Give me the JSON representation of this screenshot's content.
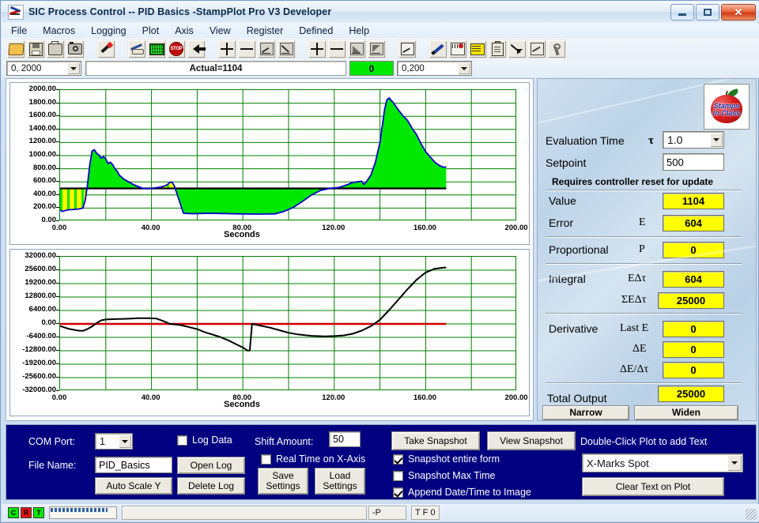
{
  "window": {
    "title": "SIC Process Control -- PID Basics -StampPlot Pro V3 Developer",
    "minimize_label": "Minimize",
    "maximize_label": "Maximize",
    "close_label": "Close"
  },
  "menu": {
    "items": [
      "File",
      "Macros",
      "Logging",
      "Plot",
      "Axis",
      "View",
      "Register",
      "Defined",
      "Help"
    ]
  },
  "toolbar": {
    "groups": [
      {
        "buttons": [
          {
            "name": "open-file-icon",
            "icon": "folder"
          },
          {
            "name": "save-file-icon",
            "icon": "disk"
          },
          {
            "name": "print-icon",
            "icon": "printer"
          },
          {
            "name": "snapshot-camera-icon",
            "icon": "camera"
          }
        ]
      },
      {
        "buttons": [
          {
            "name": "wand-icon",
            "icon": "wand"
          }
        ]
      },
      {
        "buttons": [
          {
            "name": "connect-icon",
            "icon": "science"
          },
          {
            "name": "display-icon",
            "icon": "display"
          },
          {
            "name": "stop-icon",
            "icon": "stop"
          },
          {
            "name": "back-arrow-icon",
            "icon": "arrow-left"
          }
        ]
      },
      {
        "buttons": [
          {
            "name": "y-zoom-in-icon",
            "icon": "plus"
          },
          {
            "name": "y-zoom-out-icon",
            "icon": "minus"
          },
          {
            "name": "y-scale-up-icon",
            "icon": "box-up"
          },
          {
            "name": "y-scale-down-icon",
            "icon": "box-down"
          }
        ]
      },
      {
        "buttons": [
          {
            "name": "x-zoom-in-icon",
            "icon": "plus"
          },
          {
            "name": "x-zoom-out-icon",
            "icon": "minus"
          },
          {
            "name": "x-scale-up-icon",
            "icon": "box-tri"
          },
          {
            "name": "x-scale-down-icon",
            "icon": "box-tri2"
          }
        ]
      },
      {
        "buttons": [
          {
            "name": "autoscale-icon",
            "icon": "chart"
          }
        ]
      },
      {
        "buttons": [
          {
            "name": "pen-icon",
            "icon": "pen"
          },
          {
            "name": "text-icon",
            "icon": "abc"
          },
          {
            "name": "note-icon",
            "icon": "note"
          },
          {
            "name": "clipboard-icon",
            "icon": "clip"
          },
          {
            "name": "pointer-icon",
            "icon": "arrow-dr"
          },
          {
            "name": "trend-icon",
            "icon": "zigzag"
          },
          {
            "name": "settings-wrench-icon",
            "icon": "wrench"
          }
        ]
      }
    ]
  },
  "toolrow2": {
    "y_range_value": "0, 2000",
    "status_text": "Actual=1104",
    "counter_value": "0",
    "x_range_value": "0,200"
  },
  "chart_data": [
    {
      "type": "area",
      "name": "process-value-chart",
      "title": "",
      "xlabel": "Seconds",
      "ylabel": "",
      "xlim": [
        0,
        200
      ],
      "ylim": [
        0,
        2000
      ],
      "xticks": [
        "0.00",
        "40.00",
        "80.00",
        "120.00",
        "160.00",
        "200.00"
      ],
      "xtick_values": [
        0,
        40,
        80,
        120,
        160,
        200
      ],
      "yticks": [
        "0.00",
        "200.00",
        "400.00",
        "600.00",
        "800.00",
        "1000.00",
        "1200.00",
        "1400.00",
        "1600.00",
        "1800.00",
        "2000.00"
      ],
      "ytick_values": [
        0,
        200,
        400,
        600,
        800,
        1000,
        1200,
        1400,
        1600,
        1800,
        2000
      ],
      "grid": true,
      "grid_color": "#008000",
      "setpoint": 500,
      "setpoint_color": "#000000",
      "fill_color": "#00e800",
      "hatch_color": "#ffff00",
      "series": [
        {
          "name": "Actual",
          "color": "#0000cd",
          "x": [
            0,
            1,
            2,
            3,
            4,
            6,
            8,
            10,
            11,
            12,
            13,
            14,
            15,
            16,
            17,
            18,
            19,
            20,
            21,
            22,
            23,
            24,
            25,
            26,
            28,
            30,
            32,
            34,
            36,
            38,
            40,
            42,
            44,
            46,
            47,
            48,
            49,
            50,
            54,
            58,
            62,
            66,
            70,
            74,
            78,
            82,
            86,
            90,
            94,
            98,
            102,
            106,
            110,
            114,
            118,
            122,
            126,
            128,
            130,
            132,
            133,
            134,
            136,
            138,
            140,
            142,
            143,
            144,
            146,
            148,
            150,
            152,
            154,
            156,
            158,
            160,
            162,
            164,
            166,
            168,
            169
          ],
          "y": [
            170,
            150,
            160,
            170,
            175,
            180,
            185,
            200,
            320,
            560,
            860,
            1070,
            1090,
            1035,
            1010,
            960,
            985,
            950,
            880,
            900,
            860,
            800,
            760,
            700,
            640,
            600,
            560,
            530,
            505,
            495,
            500,
            510,
            520,
            540,
            560,
            590,
            595,
            540,
            120,
            115,
            118,
            120,
            118,
            115,
            112,
            110,
            108,
            110,
            112,
            150,
            210,
            300,
            400,
            470,
            500,
            515,
            560,
            590,
            600,
            610,
            560,
            600,
            700,
            900,
            1200,
            1700,
            1850,
            1880,
            1800,
            1700,
            1610,
            1540,
            1420,
            1320,
            1180,
            1060,
            980,
            900,
            850,
            820,
            830
          ]
        }
      ]
    },
    {
      "type": "line",
      "name": "output-chart",
      "title": "",
      "xlabel": "Seconds",
      "ylabel": "",
      "xlim": [
        0,
        200
      ],
      "ylim": [
        -32000,
        32000
      ],
      "xticks": [
        "0.00",
        "40.00",
        "80.00",
        "120.00",
        "160.00",
        "200.00"
      ],
      "xtick_values": [
        0,
        40,
        80,
        120,
        160,
        200
      ],
      "yticks": [
        "32000.00",
        "25600.00",
        "19200.00",
        "12800.00",
        "6400.00",
        "0.00",
        "-6400.00",
        "-12800.00",
        "-19200.00",
        "-25600.00",
        "-32000.00"
      ],
      "ytick_values": [
        32000,
        25600,
        19200,
        12800,
        6400,
        0,
        -6400,
        -12800,
        -19200,
        -25600,
        -32000
      ],
      "grid": true,
      "grid_color": "#008000",
      "zero_line_color": "#d00000",
      "series": [
        {
          "name": "Total Output",
          "color": "#000000",
          "x": [
            0,
            4,
            8,
            10,
            12,
            14,
            16,
            18,
            20,
            24,
            28,
            32,
            34,
            38,
            42,
            44,
            46,
            48,
            52,
            56,
            60,
            64,
            66,
            70,
            74,
            78,
            80,
            82,
            83,
            84,
            88,
            92,
            96,
            100,
            104,
            110,
            116,
            120,
            124,
            128,
            132,
            136,
            140,
            144,
            148,
            152,
            156,
            160,
            164,
            168,
            169
          ],
          "y": [
            -1000,
            -2400,
            -3200,
            -3300,
            -2400,
            -1200,
            400,
            1700,
            2100,
            2300,
            2400,
            2600,
            2700,
            2700,
            2600,
            1800,
            1000,
            0,
            -400,
            -1400,
            -2500,
            -4200,
            -4800,
            -6200,
            -8000,
            -10200,
            -11200,
            -12700,
            -12700,
            0,
            -900,
            -1800,
            -3000,
            -4200,
            -5000,
            -5700,
            -5900,
            -5800,
            -5500,
            -4700,
            -3200,
            -1100,
            2000,
            6600,
            11500,
            16500,
            21000,
            24500,
            26300,
            26800,
            26800
          ]
        }
      ]
    }
  ],
  "pid_panel": {
    "logo_alt": "Stamps in Class",
    "logo_line1": "Stamps",
    "logo_line2": "in Class",
    "evaluation_time_label": "Evaluation Time",
    "evaluation_time_symbol": "τ",
    "evaluation_time_value": "1.0",
    "setpoint_label": "Setpoint",
    "setpoint_value": "500",
    "reset_note": "Requires controller reset for update",
    "value_label": "Value",
    "value_value": "1104",
    "error_label": "Error",
    "error_symbol": "E",
    "error_value": "604",
    "proportional_label": "Proportional",
    "proportional_symbol": "P",
    "proportional_value": "0",
    "integral_label": "Integral",
    "integral_symbol1": "EΔτ",
    "integral_value1": "604",
    "integral_symbol2": "ΣEΔτ",
    "integral_value2": "25000",
    "derivative_label": "Derivative",
    "derivative_symbol1": "Last E",
    "derivative_value1": "0",
    "derivative_symbol2": "ΔE",
    "derivative_value2": "0",
    "derivative_symbol3": "ΔE/Δτ",
    "derivative_value3": "0",
    "total_output_label": "Total Output",
    "total_output_value": "25000",
    "narrow_label": "Narrow",
    "widen_label": "Widen"
  },
  "bottom_panel": {
    "com_port_label": "COM Port:",
    "com_port_value": "1",
    "file_name_label": "File Name:",
    "file_name_value": "PID_Basics",
    "auto_scale_y_label": "Auto Scale Y",
    "open_log_label": "Open Log",
    "delete_log_label": "Delete Log",
    "log_data_label": "Log Data",
    "log_data_checked": false,
    "shift_amount_label": "Shift Amount:",
    "shift_amount_value": "50",
    "real_time_label": "Real Time on X-Axis",
    "real_time_checked": false,
    "save_settings_label": "Save\nSettings",
    "save_settings_line1": "Save",
    "save_settings_line2": "Settings",
    "load_settings_line1": "Load",
    "load_settings_line2": "Settings",
    "take_snapshot_label": "Take Snapshot",
    "view_snapshot_label": "View Snapshot",
    "snapshot_entire_form_label": "Snapshot entire form",
    "snapshot_entire_form_checked": true,
    "snapshot_max_time_label": "Snapshot Max Time",
    "snapshot_max_time_checked": false,
    "append_datetime_label": "Append Date/Time to Image",
    "append_datetime_checked": true,
    "double_click_label": "Double-Click Plot to add Text",
    "text_mode_value": "X-Marks Spot",
    "clear_text_label": "Clear Text on Plot"
  },
  "status_bar": {
    "led_c": "C",
    "led_r": "R",
    "led_t": "T",
    "cell_p": "-P",
    "cell_tf": "T F 0"
  },
  "colors": {
    "blue_panel": "#000080",
    "yellow_field": "#ffff00",
    "green_value": "#00e800",
    "grid_green": "#008000",
    "trace_blue": "#0000cd",
    "zero_red": "#d00000"
  }
}
